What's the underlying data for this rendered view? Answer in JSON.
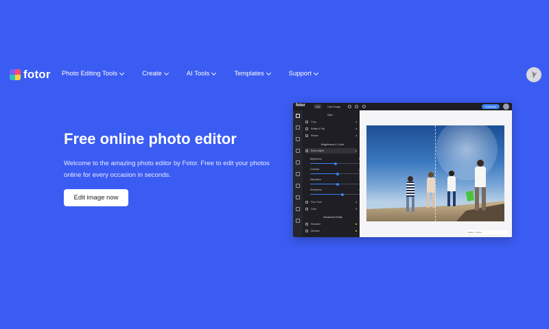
{
  "header": {
    "logo_text": "fotor",
    "nav": [
      {
        "label": "Photo Editing Tools"
      },
      {
        "label": "Create"
      },
      {
        "label": "AI Tools"
      },
      {
        "label": "Templates"
      },
      {
        "label": "Support"
      }
    ]
  },
  "hero": {
    "title": "Free online photo editor",
    "description": "Welcome to the amazing photo editor by Fotor. Free to edit your photos online for every occasion in seconds.",
    "cta_label": "Edit image now"
  },
  "editor": {
    "logo": "fotor",
    "tab_edit": "Edit",
    "open_image": "Open Image",
    "download": "Download",
    "panel_title": "Size",
    "size_items": [
      "Crop",
      "Rotate & Flip",
      "Resize"
    ],
    "section_bc": "Brightness & Color",
    "basic_adjust": "Basic Adjust",
    "sliders": [
      {
        "label": "Brightness",
        "value": "50"
      },
      {
        "label": "Contrast",
        "value": "45"
      },
      {
        "label": "Saturation",
        "value": "50"
      },
      {
        "label": "Sharpness",
        "value": "45"
      }
    ],
    "color_items": [
      "Fine Tune",
      "Color"
    ],
    "advanced": "Advanced Edits",
    "advanced_items": [
      "Structure",
      "Denoise"
    ],
    "zoom_text": "1280px × 851px"
  },
  "colors": {
    "background": "#3b5cf2",
    "cta_bg": "#ffffff",
    "accent": "#3b82f6"
  }
}
